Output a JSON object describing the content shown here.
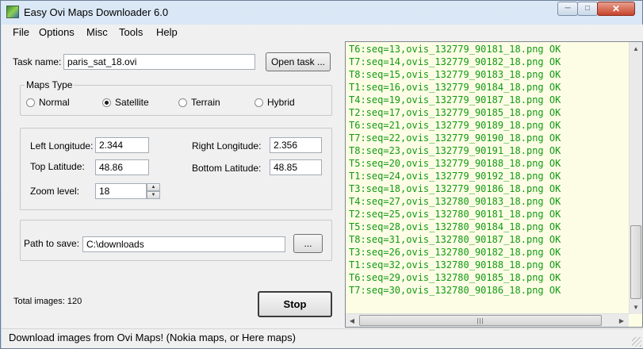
{
  "window": {
    "title": "Easy Ovi Maps Downloader 6.0"
  },
  "menu": [
    {
      "label": "File"
    },
    {
      "label": "Options"
    },
    {
      "label": "Misc"
    },
    {
      "label": "Tools"
    },
    {
      "label": "Help"
    }
  ],
  "task": {
    "label": "Task name:",
    "value": "paris_sat_18.ovi",
    "open_button": "Open task ..."
  },
  "maps_type": {
    "title": "Maps Type",
    "options": [
      "Normal",
      "Satellite",
      "Terrain",
      "Hybrid"
    ],
    "selected": "Satellite"
  },
  "coords": {
    "left_longitude_label": "Left Longitude:",
    "left_longitude": "2.344",
    "right_longitude_label": "Right Longitude:",
    "right_longitude": "2.356",
    "top_latitude_label": "Top Latitude:",
    "top_latitude": "48.86",
    "bottom_latitude_label": "Bottom Latitude:",
    "bottom_latitude": "48.85",
    "zoom_label": "Zoom level:",
    "zoom": "18"
  },
  "path": {
    "label": "Path to save:",
    "value": "C:\\downloads",
    "browse_button": "..."
  },
  "total_images": "Total images: 120",
  "stop_button": "Stop",
  "log": [
    "T6:seq=13,ovis_132779_90181_18.png OK",
    "T7:seq=14,ovis_132779_90182_18.png OK",
    "T8:seq=15,ovis_132779_90183_18.png OK",
    "T1:seq=16,ovis_132779_90184_18.png OK",
    "T4:seq=19,ovis_132779_90187_18.png OK",
    "T2:seq=17,ovis_132779_90185_18.png OK",
    "T6:seq=21,ovis_132779_90189_18.png OK",
    "T7:seq=22,ovis_132779_90190_18.png OK",
    "T8:seq=23,ovis_132779_90191_18.png OK",
    "T5:seq=20,ovis_132779_90188_18.png OK",
    "T1:seq=24,ovis_132779_90192_18.png OK",
    "T3:seq=18,ovis_132779_90186_18.png OK",
    "T4:seq=27,ovis_132780_90183_18.png OK",
    "T2:seq=25,ovis_132780_90181_18.png OK",
    "T5:seq=28,ovis_132780_90184_18.png OK",
    "T8:seq=31,ovis_132780_90187_18.png OK",
    "T3:seq=26,ovis_132780_90182_18.png OK",
    "T1:seq=32,ovis_132780_90188_18.png OK",
    "T6:seq=29,ovis_132780_90185_18.png OK",
    "T7:seq=30,ovis_132780_90186_18.png OK"
  ],
  "status": "Download images from Ovi Maps! (Nokia maps, or Here maps)",
  "colors": {
    "log_text": "#129b12",
    "log_background": "#fdfde6"
  }
}
